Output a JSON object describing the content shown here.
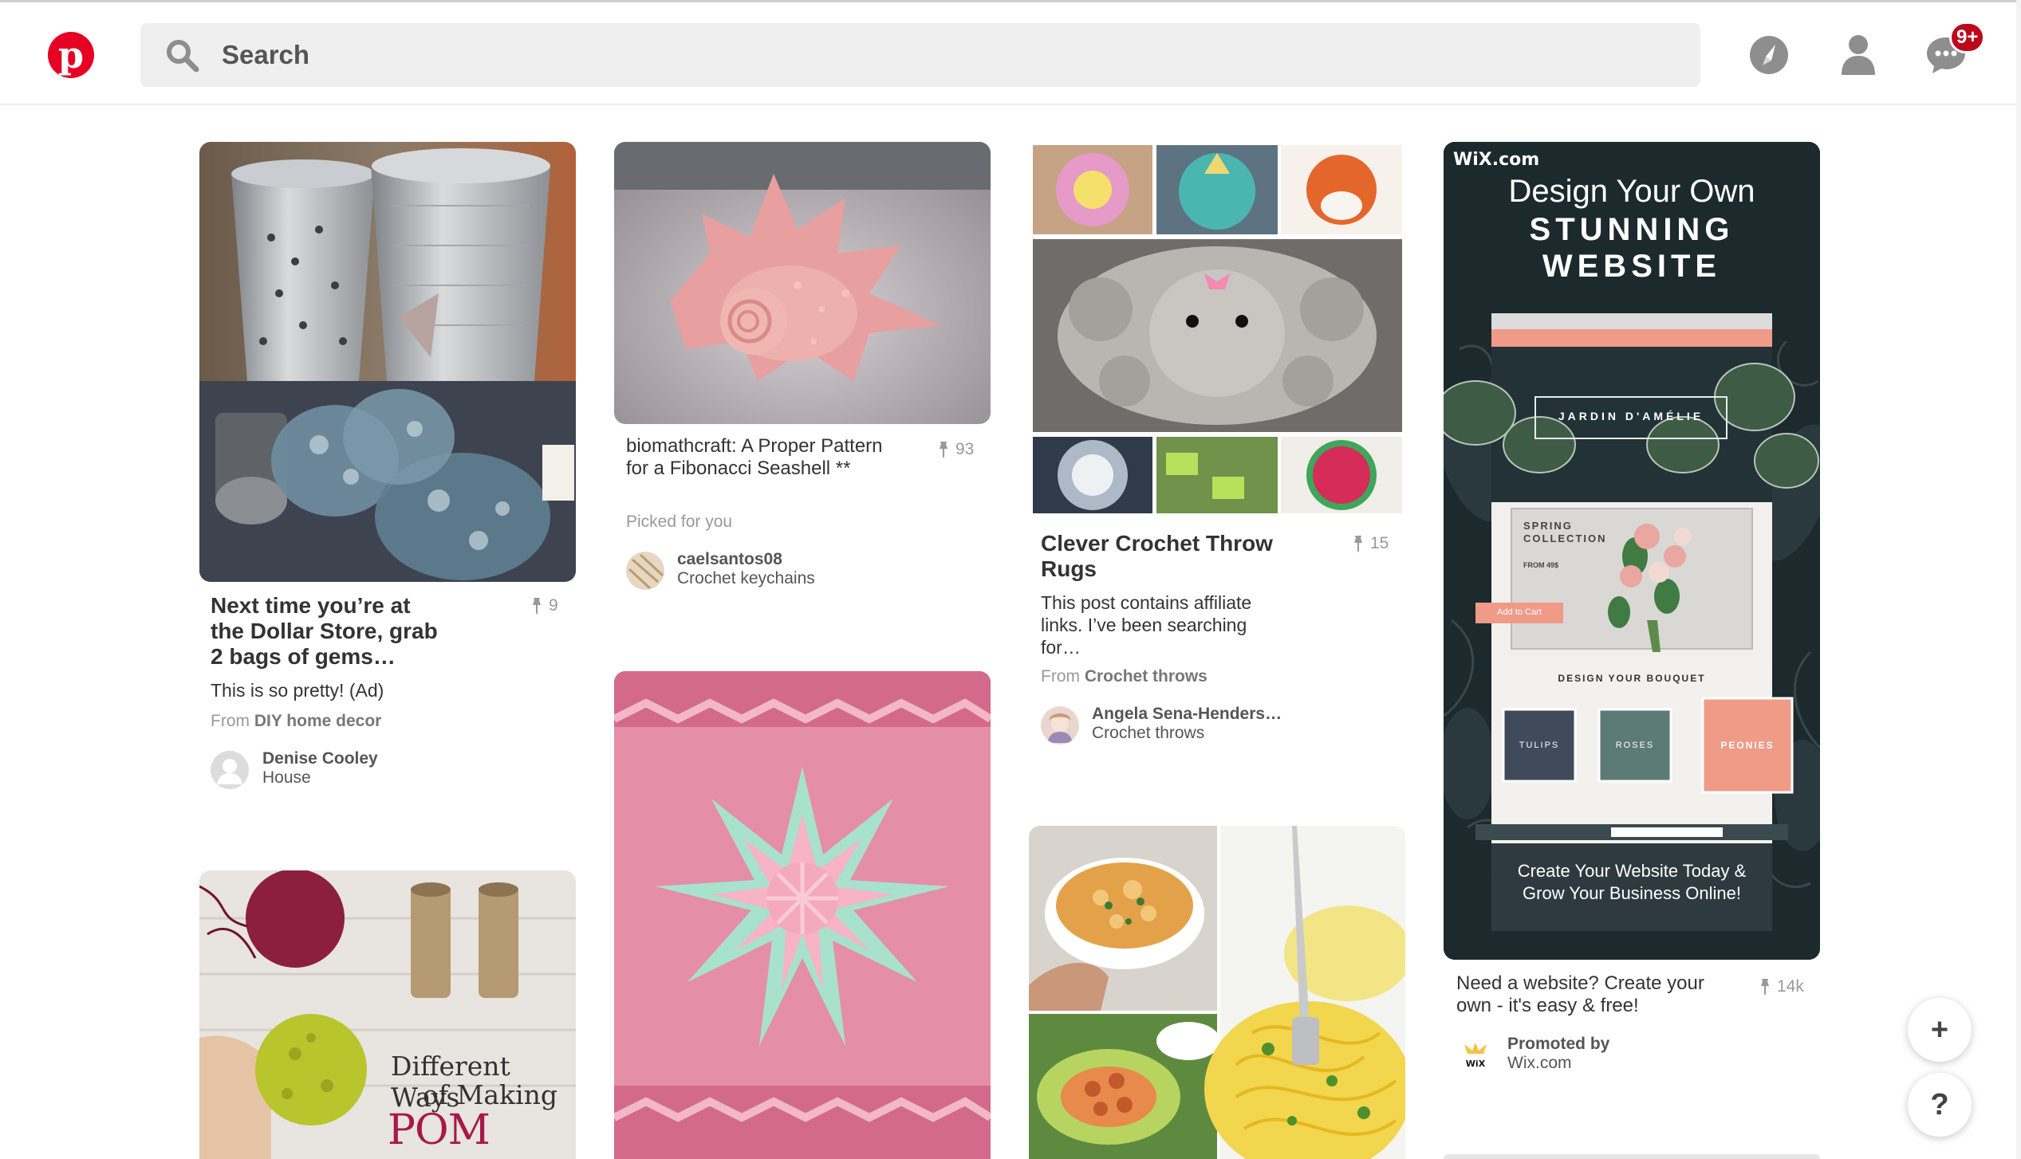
{
  "app": {
    "name": "Pinterest"
  },
  "colors": {
    "brand": "#e60023",
    "badge": "#bd081c"
  },
  "header": {
    "search_placeholder": "Search",
    "notification_badge": "9+",
    "icons": [
      "pinterest-logo-icon",
      "search-icon",
      "compass-icon",
      "user-icon",
      "chat-bubble-icon"
    ]
  },
  "pins": {
    "p1": {
      "title": "Next time you’re at the Dollar Store, grab 2 bags of gems…",
      "count": "9",
      "desc": "This is so pretty! (Ad)",
      "from_label": "From",
      "from_board": "DIY home decor",
      "user": "Denise Cooley",
      "board": "House"
    },
    "p2": {
      "title": "biomathcraft: A Proper Pattern for a Fibonacci Seashell **",
      "count": "93",
      "picked": "Picked for you",
      "user": "caelsantos08",
      "board": "Crochet keychains"
    },
    "p3": {
      "title": "Clever Crochet Throw Rugs",
      "count": "15",
      "desc": "This post contains affiliate links. I’ve been searching for…",
      "from_label": "From",
      "from_board": "Crochet throws",
      "user": "Angela Sena-Henders…",
      "board": "Crochet throws"
    },
    "p4": {
      "title": "Need a website? Create your own - it's easy & free!",
      "count": "14k",
      "promoted": "Promoted by",
      "user": "Wix.com"
    },
    "p5": {
      "overlay1": "Different Ways",
      "overlay2": "of Making",
      "overlay3": "POM POMS"
    }
  },
  "wix_ad": {
    "brand": "WiX.com",
    "headline1": "Design Your Own",
    "headline2": "STUNNING",
    "headline3": "WEBSITE",
    "site_name": "JARDIN D'AMÉLIE",
    "spring": "SPRING",
    "collection": "COLLECTION",
    "from_price": "FROM 49$",
    "add_cart": "Add to Cart",
    "design_bouquet": "DESIGN YOUR BOUQUET",
    "tulips": "TULIPS",
    "roses": "ROSES",
    "peonies": "PEONIES",
    "cta1": "Create Your Website Today &",
    "cta2": "Grow Your Business Online!"
  },
  "fabs": {
    "add": "+",
    "help": "?"
  }
}
